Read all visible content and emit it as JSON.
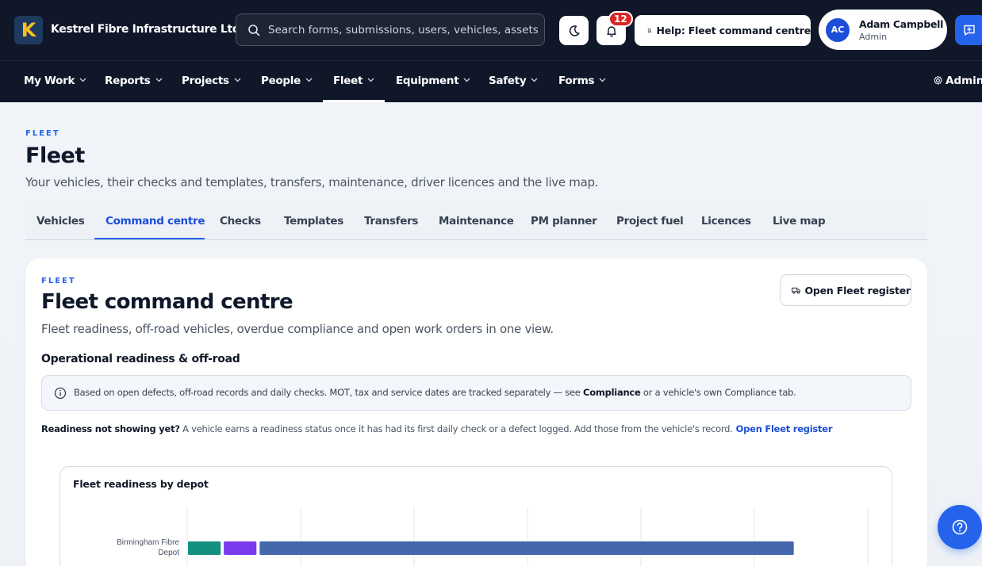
{
  "app": {
    "company": "Kestrel Fibre Infrastructure Ltd",
    "logo_letter": "K"
  },
  "search": {
    "placeholder": "Search forms, submissions, users, vehicles, assets and more"
  },
  "notifications": {
    "count": "12"
  },
  "help": {
    "label": "Help: Fleet command centre"
  },
  "user": {
    "initials": "AC",
    "name": "Adam Campbell",
    "role": "Admin"
  },
  "nav": {
    "items": [
      "My Work",
      "Reports",
      "Projects",
      "People",
      "Fleet",
      "Equipment",
      "Safety",
      "Forms"
    ],
    "active": "Fleet",
    "admin": "Admin"
  },
  "page": {
    "eyebrow": "FLEET",
    "title": "Fleet",
    "subtitle": "Your vehicles, their checks and templates, transfers, maintenance, driver licences and the live map."
  },
  "tabs": {
    "items": [
      "Vehicles",
      "Command centre",
      "Checks",
      "Templates",
      "Transfers",
      "Maintenance",
      "PM planner",
      "Project fuel",
      "Licences",
      "Live map"
    ],
    "active": "Command centre"
  },
  "card": {
    "eyebrow": "FLEET",
    "title": "Fleet command centre",
    "subtitle": "Fleet readiness, off-road vehicles, overdue compliance and open work orders in one view.",
    "open_register": "Open Fleet register",
    "section_title": "Operational readiness & off-road",
    "info_prefix": "Based on open defects, off-road records and daily checks. MOT, tax and service dates are tracked separately — see ",
    "info_bold": "Compliance",
    "info_suffix": " or a vehicle's own Compliance tab.",
    "hint_bold": "Readiness not showing yet?",
    "hint_text": " A vehicle earns a readiness status once it has had its first daily check or a defect logged. Add those from the vehicle's record.",
    "hint_link": "Open Fleet register"
  },
  "colors": {
    "nav_bg": "#0f1729",
    "accent": "#2563eb",
    "badge": "#dc2626"
  },
  "chart_data": {
    "type": "bar",
    "title": "Fleet readiness by depot",
    "orientation": "horizontal",
    "stacked": true,
    "categories": [
      "Birmingham Fibre Depot"
    ],
    "series": [
      {
        "values": [
          1
        ],
        "color": "#14907f"
      },
      {
        "values": [
          1
        ],
        "color": "#7c3aed"
      },
      {
        "values": [
          15
        ],
        "color": "#4467ad"
      }
    ],
    "xlim": [
      0,
      19
    ],
    "grid": true
  }
}
